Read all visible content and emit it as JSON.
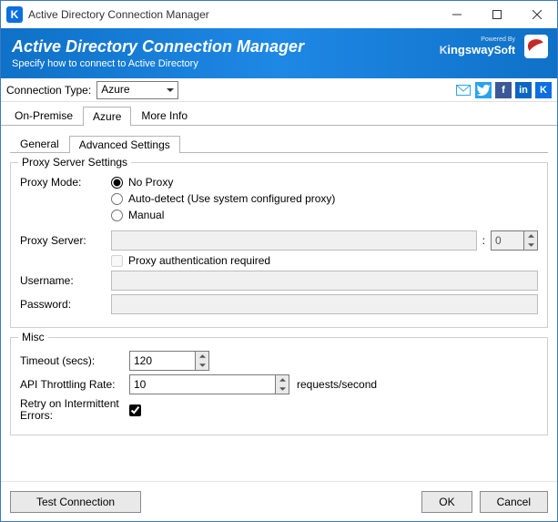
{
  "window": {
    "title": "Active Directory Connection Manager"
  },
  "banner": {
    "title": "Active Directory Connection Manager",
    "subtitle": "Specify how to connect to Active Directory",
    "powered_by": "Powered By",
    "vendor": "KingswaySoft"
  },
  "conn": {
    "label": "Connection Type:",
    "value": "Azure"
  },
  "tabs": {
    "items": [
      {
        "label": "On-Premise",
        "active": false
      },
      {
        "label": "Azure",
        "active": true
      },
      {
        "label": "More Info",
        "active": false
      }
    ]
  },
  "subtabs": {
    "items": [
      {
        "label": "General",
        "active": false
      },
      {
        "label": "Advanced Settings",
        "active": true
      }
    ]
  },
  "proxy": {
    "legend": "Proxy Server Settings",
    "mode_label": "Proxy Mode:",
    "options": {
      "none": "No Proxy",
      "auto": "Auto-detect (Use system configured proxy)",
      "manual": "Manual"
    },
    "selected": "none",
    "server_label": "Proxy Server:",
    "server_value": "",
    "port_value": "0",
    "auth_required_label": "Proxy authentication required",
    "auth_required": false,
    "username_label": "Username:",
    "username_value": "",
    "password_label": "Password:",
    "password_value": ""
  },
  "misc": {
    "legend": "Misc",
    "timeout_label": "Timeout (secs):",
    "timeout_value": "120",
    "throttle_label": "API Throttling Rate:",
    "throttle_value": "10",
    "throttle_unit": "requests/second",
    "retry_label": "Retry on Intermittent Errors:",
    "retry_checked": true
  },
  "buttons": {
    "test": "Test Connection",
    "ok": "OK",
    "cancel": "Cancel"
  }
}
